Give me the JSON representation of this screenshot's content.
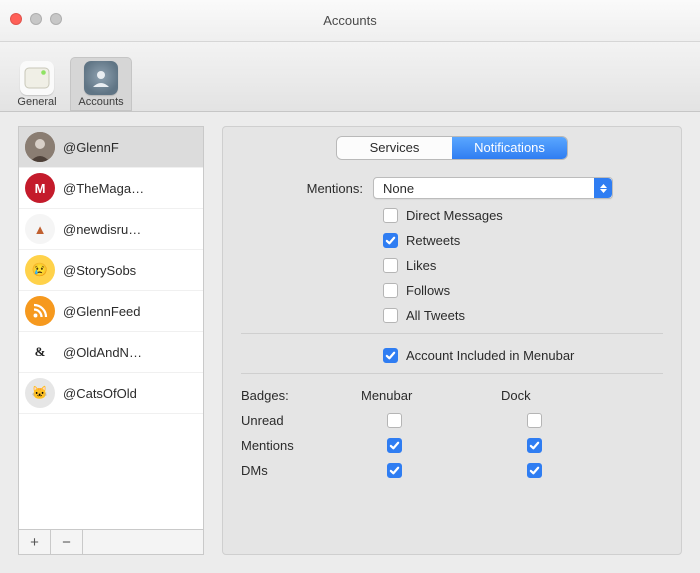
{
  "window": {
    "title": "Accounts"
  },
  "toolbar": {
    "general_label": "General",
    "accounts_label": "Accounts",
    "selected": "accounts"
  },
  "accounts": [
    {
      "handle": "@GlennF",
      "avatar_bg": "#8a7d72",
      "avatar_text": "",
      "selected": true
    },
    {
      "handle": "@TheMaga…",
      "avatar_bg": "#c41b2b",
      "avatar_text": "M",
      "selected": false
    },
    {
      "handle": "@newdisru…",
      "avatar_bg": "#f5f5f5",
      "avatar_text": "▲",
      "selected": false,
      "avatar_fg": "#c06030"
    },
    {
      "handle": "@StorySobs",
      "avatar_bg": "#ffd24a",
      "avatar_text": "😢",
      "selected": false
    },
    {
      "handle": "@GlennFeed",
      "avatar_bg": "#f6991e",
      "avatar_text": "",
      "selected": false,
      "rss": true
    },
    {
      "handle": "@OldAndN…",
      "avatar_bg": "#ffffff",
      "avatar_text": "&",
      "selected": false,
      "avatar_fg": "#222",
      "serif": true
    },
    {
      "handle": "@CatsOfOld",
      "avatar_bg": "#e6e6e6",
      "avatar_text": "🐱",
      "selected": false,
      "avatar_fg": "#555"
    }
  ],
  "list_footer": {
    "add": "+",
    "remove": "−"
  },
  "tabs": {
    "services": "Services",
    "notifications": "Notifications",
    "active": "notifications"
  },
  "mentions": {
    "label": "Mentions:",
    "value": "None"
  },
  "notif_options": [
    {
      "label": "Direct Messages",
      "checked": false
    },
    {
      "label": "Retweets",
      "checked": true
    },
    {
      "label": "Likes",
      "checked": false
    },
    {
      "label": "Follows",
      "checked": false
    },
    {
      "label": "All Tweets",
      "checked": false
    }
  ],
  "menubar_include": {
    "label": "Account Included in Menubar",
    "checked": true
  },
  "badges": {
    "heading": "Badges:",
    "cols": [
      "Menubar",
      "Dock"
    ],
    "rows": [
      {
        "label": "Unread",
        "menubar": false,
        "dock": false
      },
      {
        "label": "Mentions",
        "menubar": true,
        "dock": true
      },
      {
        "label": "DMs",
        "menubar": true,
        "dock": true
      }
    ]
  }
}
